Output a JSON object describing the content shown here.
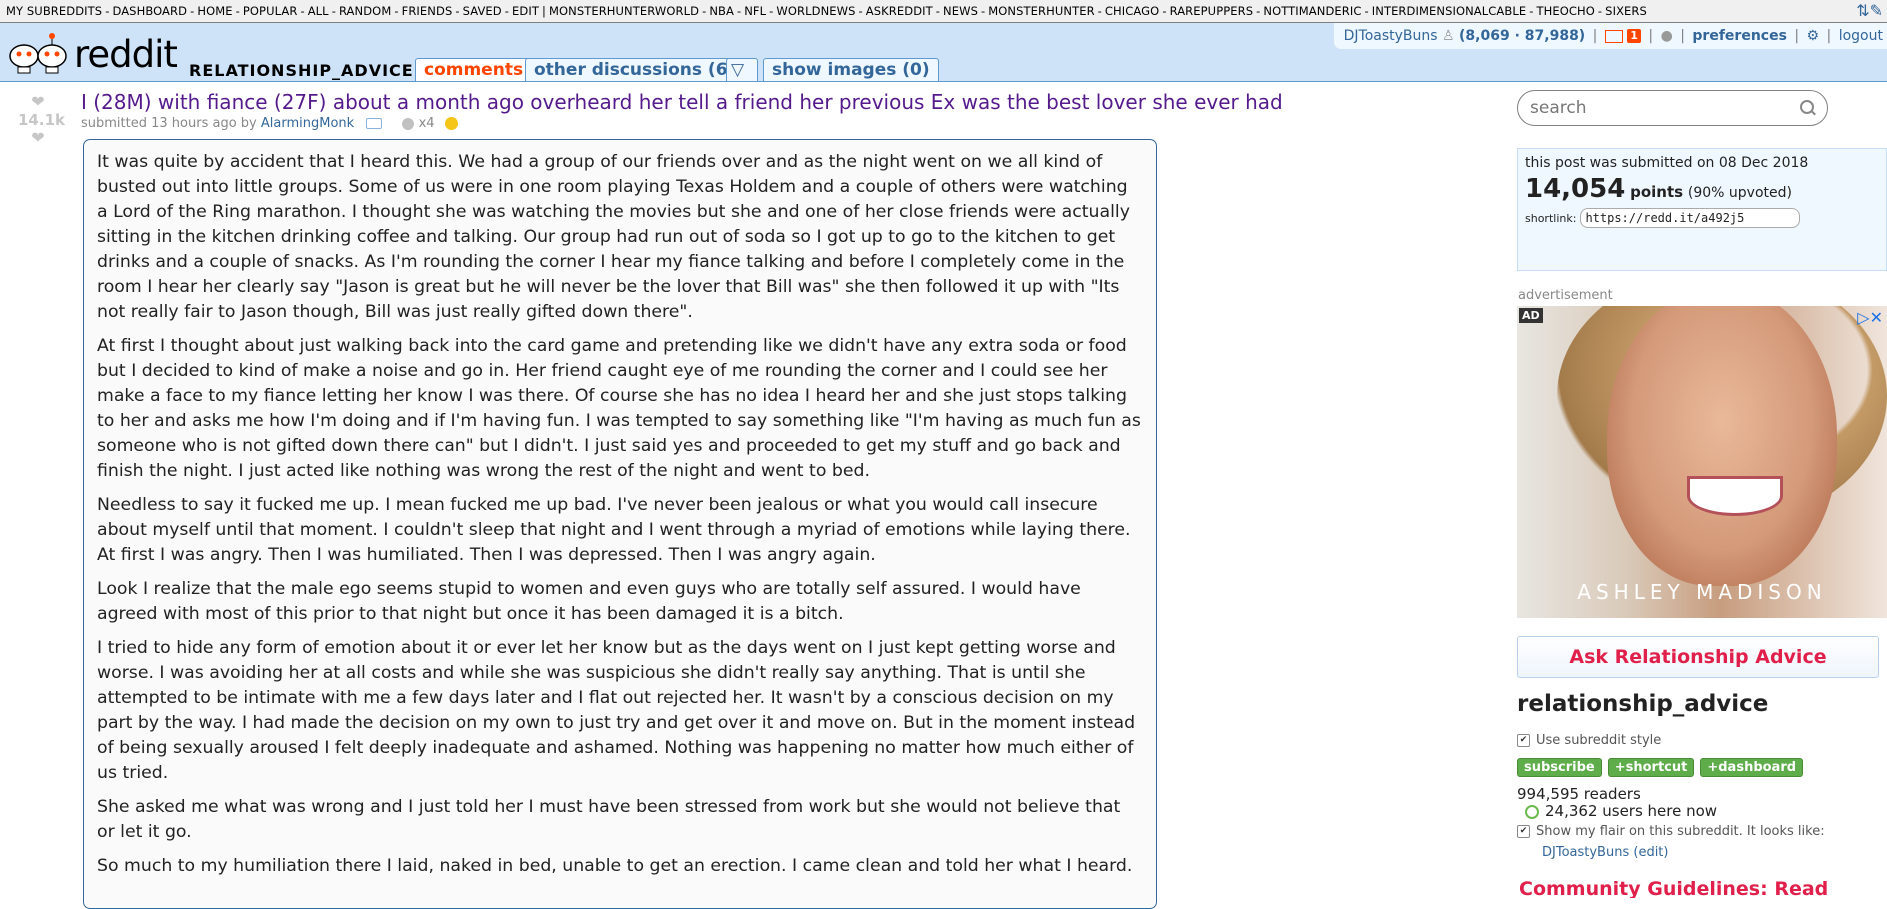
{
  "top_bar": {
    "items": [
      "MY SUBREDDITS",
      "DASHBOARD",
      "HOME",
      "POPULAR",
      "ALL",
      "RANDOM",
      "FRIENDS",
      "SAVED",
      "EDIT"
    ],
    "subs": [
      "MONSTERHUNTERWORLD",
      "NBA",
      "NFL",
      "WORLDNEWS",
      "ASKREDDIT",
      "NEWS",
      "MONSTERHUNTER",
      "CHICAGO",
      "RAREPUPPERS",
      "NOTTIMANDERIC",
      "INTERDIMENSIONALCABLE",
      "THEOCHO",
      "SIXERS"
    ]
  },
  "header": {
    "wordmark": "reddit",
    "page_name": "RELATIONSHIP_ADVICE",
    "tabs": [
      {
        "label": "comments"
      },
      {
        "label": "other discussions (6)"
      },
      {
        "label": "show images (0)"
      }
    ],
    "user": {
      "name": "DJToastyBuns",
      "karma": "(8,069 · 87,988)",
      "mail_count": "1",
      "preferences": "preferences",
      "logout": "logout"
    }
  },
  "post": {
    "score": "14.1k",
    "title": "I (28M) with fiance (27F) about a month ago overheard her tell a friend her previous Ex was the best lover she ever had",
    "submitted_prefix": "submitted 13 hours ago by",
    "author": "AlarmingMonk",
    "silver_count": "x4",
    "paragraphs": [
      "It was quite by accident that I heard this. We had a group of our friends over and as the night went on we all kind of busted out into little groups. Some of us were in one room playing Texas Holdem and a couple of others were watching a Lord of the Ring marathon. I thought she was watching the movies but she and one of her close friends were actually sitting in the kitchen drinking coffee and talking. Our group had run out of soda so I got up to go to the kitchen to get drinks and a couple of snacks. As I'm rounding the corner I hear my fiance talking and before I completely come in the room I hear her clearly say \"Jason is great but he will never be the lover that Bill was\" she then followed it up with \"Its not really fair to Jason though, Bill was just really gifted down there\".",
      "At first I thought about just walking back into the card game and pretending like we didn't have any extra soda or food but I decided to kind of make a noise and go in. Her friend caught eye of me rounding the corner and I could see her make a face to my fiance letting her know I was there. Of course she has no idea I heard her and she just stops talking to her and asks me how I'm doing and if I'm having fun. I was tempted to say something like \"I'm having as much fun as someone who is not gifted down there can\" but I didn't. I just said yes and proceeded to get my stuff and go back and finish the night. I just acted like nothing was wrong the rest of the night and went to bed.",
      "Needless to say it fucked me up. I mean fucked me up bad. I've never been jealous or what you would call insecure about myself until that moment. I couldn't sleep that night and I went through a myriad of emotions while laying there. At first I was angry. Then I was humiliated. Then I was depressed. Then I was angry again.",
      "Look I realize that the male ego seems stupid to women and even guys who are totally self assured. I would have agreed with most of this prior to that night but once it has been damaged it is a bitch.",
      "I tried to hide any form of emotion about it or ever let her know but as the days went on I just kept getting worse and worse. I was avoiding her at all costs and while she was suspicious she didn't really say anything. That is until she attempted to be intimate with me a few days later and I flat out rejected her. It wasn't by a conscious decision on my part by the way. I had made the decision on my own to just try and get over it and move on. But in the moment instead of being sexually aroused I felt deeply inadequate and ashamed. Nothing was happening no matter how much either of us tried.",
      "She asked me what was wrong and I just told her I must have been stressed from work but she would not believe that or let it go.",
      "So much to my humiliation there I laid, naked in bed, unable to get an erection. I came clean and told her what I heard."
    ]
  },
  "sidebar": {
    "search_placeholder": "search",
    "linkinfo": {
      "date": "this post was submitted on 08 Dec 2018",
      "points": "14,054",
      "points_label": "points",
      "upvoted": "(90% upvoted)",
      "shortlink_label": "shortlink:",
      "shortlink": "https://redd.it/a492j5"
    },
    "ad_label": "advertisement",
    "ad_tag": "AD",
    "ad_brand": "ASHLEY MADISON",
    "ask_button": "Ask Relationship Advice",
    "sr_name": "relationship_advice",
    "use_style": "Use subreddit style",
    "buttons": [
      "subscribe",
      "+shortcut",
      "+dashboard"
    ],
    "readers": "994,595 readers",
    "online": "24,362 users here now",
    "flair_pref": "Show my flair on this subreddit. It looks like:",
    "flair_user": "DJToastyBuns",
    "flair_edit": "(edit)",
    "guidelines": "Community Guidelines: Read"
  },
  "colors": {
    "accent": "#ff4500",
    "link": "#369",
    "header_bg": "#cee3f8",
    "visited_title": "#551a8b"
  }
}
